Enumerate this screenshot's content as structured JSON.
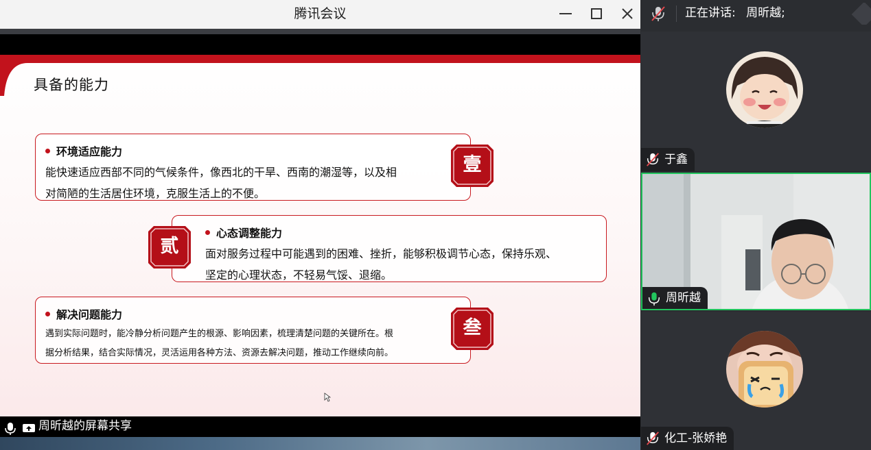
{
  "window": {
    "title": "腾讯会议"
  },
  "slide": {
    "title": "具备的能力",
    "cards": [
      {
        "badge": "壹",
        "heading": "环境适应能力",
        "lines": [
          "能快速适应西部不同的气候条件，像西北的干旱、西南的潮湿等，以及相",
          "对简陋的生活居住环境，克服生活上的不便。"
        ]
      },
      {
        "badge": "贰",
        "heading": "心态调整能力",
        "lines": [
          "面对服务过程中可能遇到的困难、挫折，能够积极调节心态，保持乐观、",
          "坚定的心理状态，不轻易气馁、退缩。"
        ]
      },
      {
        "badge": "叁",
        "heading": "解决问题能力",
        "lines": [
          "遇到实际问题时，能冷静分析问题产生的根源、影响因素，梳理清楚问题的关键所在。根",
          "据分析结果，结合实际情况，灵活运用各种方法、资源去解决问题，推动工作继续向前。"
        ]
      }
    ]
  },
  "bottom": {
    "share_label": "周昕越的屏幕共享"
  },
  "panel": {
    "speaking_label": "正在讲话:",
    "speaker_name": "周昕越;",
    "participants": [
      {
        "name": "于鑫",
        "mic": "muted"
      },
      {
        "name": "周昕越",
        "mic": "on"
      },
      {
        "name": "化工-张娇艳",
        "mic": "muted"
      }
    ]
  },
  "colors": {
    "accent_red": "#c2121c",
    "active_speaker": "#22c55e"
  },
  "icons": [
    "mic-muted-icon",
    "mic-icon",
    "screen-share-icon",
    "minimize-icon",
    "maximize-icon",
    "close-icon"
  ]
}
